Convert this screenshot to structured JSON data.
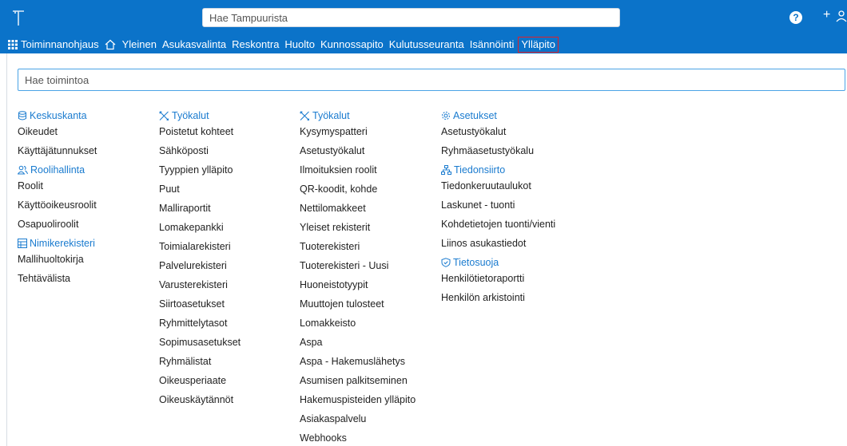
{
  "header": {
    "search_placeholder": "Hae Tampuurista",
    "help_label": "?",
    "plus_label": "+"
  },
  "nav": {
    "items": [
      "Toiminnanohjaus",
      "Yleinen",
      "Asukasvalinta",
      "Reskontra",
      "Huolto",
      "Kunnossapito",
      "Kulutusseuranta",
      "Isännöinti",
      "Ylläpito"
    ],
    "active": "Ylläpito"
  },
  "filter": {
    "placeholder": "Hae toimintoa"
  },
  "colors": {
    "brand": "#0b73c9",
    "link": "#1a7bcf",
    "active_border": "#e0202a"
  },
  "columns": [
    {
      "sections": [
        {
          "icon": "database-icon",
          "title": "Keskuskanta",
          "items": [
            "Oikeudet",
            "Käyttäjätunnukset"
          ]
        },
        {
          "icon": "users-icon",
          "title": "Roolihallinta",
          "items": [
            "Roolit",
            "Käyttöoikeusroolit",
            "Osapuoliroolit"
          ]
        },
        {
          "icon": "register-icon",
          "title": "Nimikerekisteri",
          "items": [
            "Mallihuoltokirja",
            "Tehtävälista"
          ]
        }
      ]
    },
    {
      "sections": [
        {
          "icon": "tools-icon",
          "title": "Työkalut",
          "items": [
            "Poistetut kohteet",
            "Sähköposti",
            "Tyyppien ylläpito",
            "Puut",
            "Malliraportit",
            "Lomakepankki",
            "Toimialarekisteri",
            "Palvelurekisteri",
            "Varusterekisteri",
            "Siirtoasetukset",
            "Ryhmittelytasot",
            "Sopimusasetukset",
            "Ryhmälistat",
            "Oikeusperiaate",
            "Oikeuskäytännöt"
          ]
        }
      ]
    },
    {
      "sections": [
        {
          "icon": "tools-icon",
          "title": "Työkalut",
          "items": [
            "Kysymyspatteri",
            "Asetustyökalut",
            "Ilmoituksien roolit",
            "QR-koodit, kohde",
            "Nettilomakkeet",
            "Yleiset rekisterit",
            "Tuoterekisteri",
            "Tuoterekisteri - Uusi",
            "Huoneistotyypit",
            "Muuttojen tulosteet",
            "Lomakkeisto",
            "Aspa",
            "Aspa - Hakemuslähetys",
            "Asumisen palkitseminen",
            "Hakemuspisteiden ylläpito",
            "Asiakaspalvelu",
            "Webhooks"
          ]
        }
      ]
    },
    {
      "sections": [
        {
          "icon": "gear-icon",
          "title": "Asetukset",
          "items": [
            "Asetustyökalut",
            "Ryhmäasetustyökalu"
          ]
        },
        {
          "icon": "network-icon",
          "title": "Tiedonsiirto",
          "items": [
            "Tiedonkeruutaulukot",
            "Laskunet - tuonti",
            "Kohdetietojen tuonti/vienti",
            "Liinos asukastiedot"
          ]
        },
        {
          "icon": "shield-icon",
          "title": "Tietosuoja",
          "items": [
            "Henkilötietoraportti",
            "Henkilön arkistointi"
          ]
        }
      ]
    }
  ]
}
